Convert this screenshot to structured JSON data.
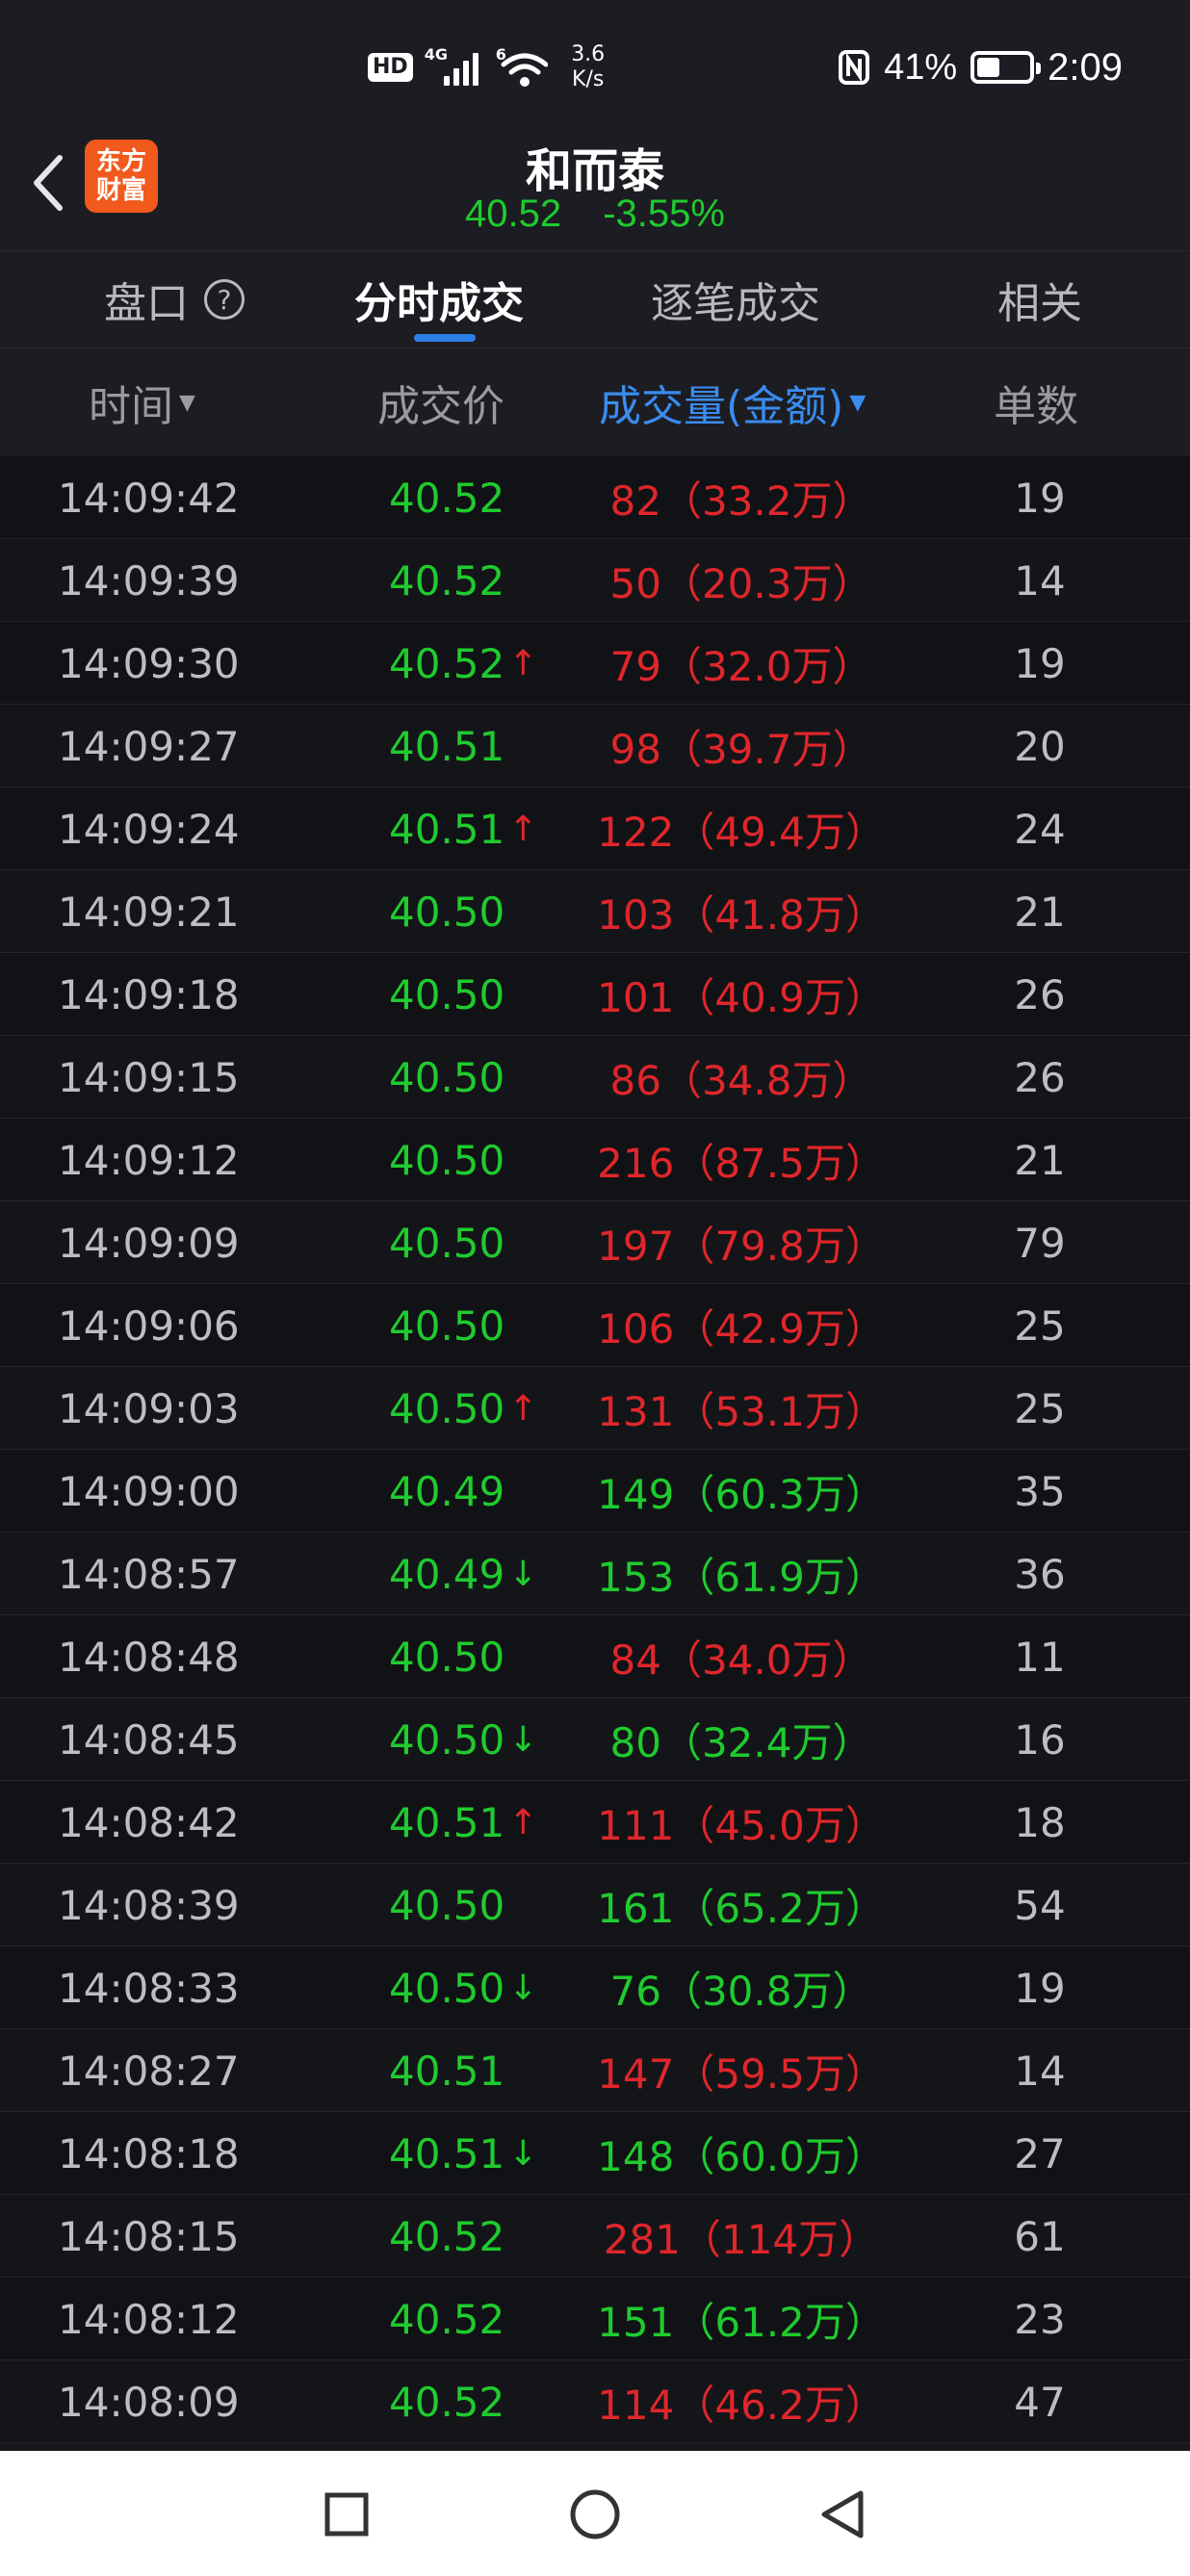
{
  "status_bar": {
    "hd": "HD",
    "network": "4G",
    "wifi": "6",
    "speed_value": "3.6",
    "speed_unit": "K/s",
    "battery": "41%",
    "time": "2:09"
  },
  "header": {
    "logo_line1": "东方",
    "logo_line2": "财富",
    "stock_name": "和而泰",
    "price": "40.52",
    "change_pct": "-3.55%"
  },
  "tabs": [
    {
      "label": "盘口"
    },
    {
      "label": "分时成交"
    },
    {
      "label": "逐笔成交"
    },
    {
      "label": "相关"
    }
  ],
  "columns": {
    "time": "时间",
    "price": "成交价",
    "volume": "成交量(金额)",
    "count": "单数"
  },
  "trades": [
    {
      "time": "14:09:42",
      "price": "40.52",
      "arrow": "",
      "volume": "82（33.2万）",
      "vol_color": "red",
      "count": "19"
    },
    {
      "time": "14:09:39",
      "price": "40.52",
      "arrow": "",
      "volume": "50（20.3万）",
      "vol_color": "red",
      "count": "14"
    },
    {
      "time": "14:09:30",
      "price": "40.52",
      "arrow": "↑",
      "volume": "79（32.0万）",
      "vol_color": "red",
      "count": "19"
    },
    {
      "time": "14:09:27",
      "price": "40.51",
      "arrow": "",
      "volume": "98（39.7万）",
      "vol_color": "red",
      "count": "20"
    },
    {
      "time": "14:09:24",
      "price": "40.51",
      "arrow": "↑",
      "volume": "122（49.4万）",
      "vol_color": "red",
      "count": "24"
    },
    {
      "time": "14:09:21",
      "price": "40.50",
      "arrow": "",
      "volume": "103（41.8万）",
      "vol_color": "red",
      "count": "21"
    },
    {
      "time": "14:09:18",
      "price": "40.50",
      "arrow": "",
      "volume": "101（40.9万）",
      "vol_color": "red",
      "count": "26"
    },
    {
      "time": "14:09:15",
      "price": "40.50",
      "arrow": "",
      "volume": "86（34.8万）",
      "vol_color": "red",
      "count": "26"
    },
    {
      "time": "14:09:12",
      "price": "40.50",
      "arrow": "",
      "volume": "216（87.5万）",
      "vol_color": "red",
      "count": "21"
    },
    {
      "time": "14:09:09",
      "price": "40.50",
      "arrow": "",
      "volume": "197（79.8万）",
      "vol_color": "red",
      "count": "79"
    },
    {
      "time": "14:09:06",
      "price": "40.50",
      "arrow": "",
      "volume": "106（42.9万）",
      "vol_color": "red",
      "count": "25"
    },
    {
      "time": "14:09:03",
      "price": "40.50",
      "arrow": "↑",
      "volume": "131（53.1万）",
      "vol_color": "red",
      "count": "25"
    },
    {
      "time": "14:09:00",
      "price": "40.49",
      "arrow": "",
      "volume": "149（60.3万）",
      "vol_color": "green",
      "count": "35"
    },
    {
      "time": "14:08:57",
      "price": "40.49",
      "arrow": "↓",
      "volume": "153（61.9万）",
      "vol_color": "green",
      "count": "36"
    },
    {
      "time": "14:08:48",
      "price": "40.50",
      "arrow": "",
      "volume": "84（34.0万）",
      "vol_color": "red",
      "count": "11"
    },
    {
      "time": "14:08:45",
      "price": "40.50",
      "arrow": "↓",
      "volume": "80（32.4万）",
      "vol_color": "green",
      "count": "16"
    },
    {
      "time": "14:08:42",
      "price": "40.51",
      "arrow": "↑",
      "volume": "111（45.0万）",
      "vol_color": "red",
      "count": "18"
    },
    {
      "time": "14:08:39",
      "price": "40.50",
      "arrow": "",
      "volume": "161（65.2万）",
      "vol_color": "green",
      "count": "54"
    },
    {
      "time": "14:08:33",
      "price": "40.50",
      "arrow": "↓",
      "volume": "76（30.8万）",
      "vol_color": "green",
      "count": "19"
    },
    {
      "time": "14:08:27",
      "price": "40.51",
      "arrow": "",
      "volume": "147（59.5万）",
      "vol_color": "red",
      "count": "14"
    },
    {
      "time": "14:08:18",
      "price": "40.51",
      "arrow": "↓",
      "volume": "148（60.0万）",
      "vol_color": "green",
      "count": "27"
    },
    {
      "time": "14:08:15",
      "price": "40.52",
      "arrow": "",
      "volume": "281（114万）",
      "vol_color": "red",
      "count": "61"
    },
    {
      "time": "14:08:12",
      "price": "40.52",
      "arrow": "",
      "volume": "151（61.2万）",
      "vol_color": "green",
      "count": "23"
    },
    {
      "time": "14:08:09",
      "price": "40.52",
      "arrow": "",
      "volume": "114（46.2万）",
      "vol_color": "red",
      "count": "47"
    }
  ],
  "colors": {
    "up": "#e0262b",
    "down": "#1fcb2e",
    "accent": "#2c7fe6",
    "logo": "#f25a1d"
  }
}
